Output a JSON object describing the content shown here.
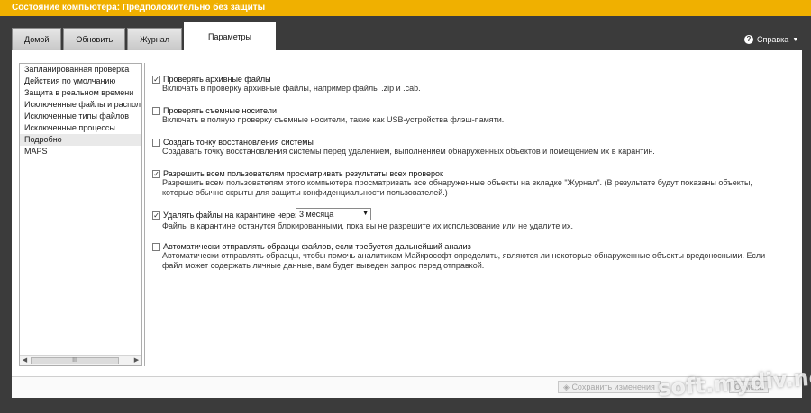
{
  "window": {
    "title": "Состояние компьютера: Предположительно без защиты"
  },
  "tabs": [
    {
      "label": "Домой"
    },
    {
      "label": "Обновить"
    },
    {
      "label": "Журнал"
    },
    {
      "label": "Параметры",
      "active": true
    }
  ],
  "help": {
    "label": "Справка"
  },
  "sidebar": {
    "items": [
      {
        "label": "Запланированная проверка"
      },
      {
        "label": "Действия по умолчанию"
      },
      {
        "label": "Защита в реальном времени"
      },
      {
        "label": "Исключенные файлы и располо"
      },
      {
        "label": "Исключенные типы файлов"
      },
      {
        "label": "Исключенные процессы"
      },
      {
        "label": "Подробно",
        "selected": true
      },
      {
        "label": "MAPS"
      }
    ],
    "scrollbar_thumb": "III"
  },
  "options": [
    {
      "checked": true,
      "label": "Проверять архивные файлы",
      "desc": "Включать в проверку архивные файлы, например файлы .zip и .cab."
    },
    {
      "checked": false,
      "label": "Проверять съемные носители",
      "desc": "Включать в полную проверку съемные носители, такие как USB-устройства флэш-памяти."
    },
    {
      "checked": false,
      "label": "Создать точку восстановления системы",
      "desc": "Создавать точку восстановления системы перед удалением, выполнением обнаруженных объектов и помещением их в карантин."
    },
    {
      "checked": true,
      "label": "Разрешить всем пользователям просматривать результаты всех проверок",
      "desc": "Разрешить всем пользователям этого компьютера просматривать все обнаруженные объекты на вкладке \"Журнал\". (В результате будут показаны объекты, которые обычно скрыты для защиты конфиденциальности пользователей.)"
    },
    {
      "checked": true,
      "label": "Удалять файлы на карантине через:",
      "desc": "Файлы в карантине останутся блокированными, пока вы не разрешите их использование или не удалите их.",
      "dropdown_value": "3 месяца"
    },
    {
      "checked": false,
      "label": "Автоматически отправлять образцы файлов, если требуется дальнейший анализ",
      "desc": "Автоматически отправлять образцы, чтобы помочь аналитикам Майкрософт определить, являются ли некоторые обнаруженные объекты вредоносными. Если файл может содержать личные данные, вам будет выведен запрос перед отправкой."
    }
  ],
  "footer": {
    "save_label": "Сохранить изменения",
    "cancel_label": "Отмена"
  },
  "watermark": "soft.mydiv.net",
  "colors": {
    "titlebar": "#f0b000",
    "chrome": "#3b3b3b"
  }
}
